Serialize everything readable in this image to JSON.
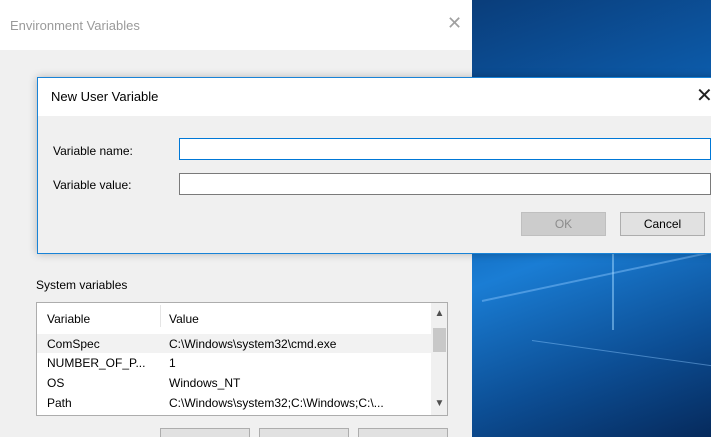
{
  "desktop": {
    "wallpaper": "windows-10-blue"
  },
  "env_window": {
    "title": "Environment Variables",
    "close_icon": "close-icon",
    "system_variables": {
      "label": "System variables",
      "columns": [
        "Variable",
        "Value"
      ],
      "rows": [
        {
          "name": "ComSpec",
          "value": "C:\\Windows\\system32\\cmd.exe"
        },
        {
          "name": "NUMBER_OF_P...",
          "value": "1"
        },
        {
          "name": "OS",
          "value": "Windows_NT"
        },
        {
          "name": "Path",
          "value": "C:\\Windows\\system32;C:\\Windows;C:\\..."
        }
      ]
    }
  },
  "dialog": {
    "title": "New User Variable",
    "close_icon": "close-icon",
    "name_label": "Variable name:",
    "name_value": "",
    "value_label": "Variable value:",
    "value_value": "",
    "ok_label": "OK",
    "cancel_label": "Cancel"
  },
  "colors": {
    "accent": "#0078d7",
    "dialog_border": "#1883d7"
  }
}
